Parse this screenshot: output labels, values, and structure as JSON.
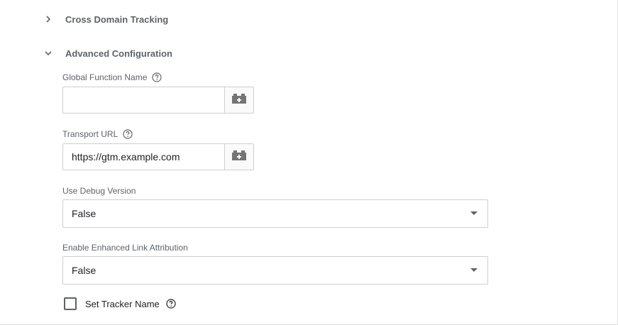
{
  "sections": {
    "cross_domain": {
      "title": "Cross Domain Tracking",
      "expanded": false
    },
    "advanced": {
      "title": "Advanced Configuration",
      "expanded": true
    }
  },
  "fields": {
    "global_function_name": {
      "label": "Global Function Name",
      "value": "",
      "help_icon": "help-circle-icon",
      "variable_icon": "variable-brick-icon"
    },
    "transport_url": {
      "label": "Transport URL",
      "value": "https://gtm.example.com",
      "help_icon": "help-circle-icon",
      "variable_icon": "variable-brick-icon"
    },
    "use_debug_version": {
      "label": "Use Debug Version",
      "selected": "False"
    },
    "enhanced_link_attribution": {
      "label": "Enable Enhanced Link Attribution",
      "selected": "False"
    },
    "set_tracker_name": {
      "label": "Set Tracker Name",
      "checked": false,
      "help_icon": "help-circle-icon"
    }
  },
  "colors": {
    "label": "#5f6368",
    "text": "#202124",
    "border": "#cfcfcf",
    "icon": "#757575"
  }
}
